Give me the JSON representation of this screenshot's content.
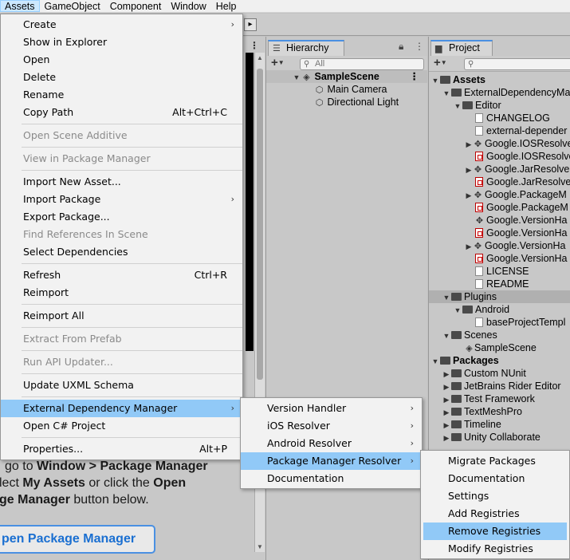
{
  "menubar": [
    "Assets",
    "GameObject",
    "Component",
    "Window",
    "Help"
  ],
  "hierarchy": {
    "tab": "Hierarchy",
    "search_placeholder": "All",
    "scene": "SampleScene",
    "items": [
      "Main Camera",
      "Directional Light"
    ]
  },
  "project": {
    "tab": "Project",
    "assets": "Assets",
    "edm": "ExternalDependencyMa",
    "editor": "Editor",
    "editor_items": [
      "CHANGELOG",
      "external-depender",
      "Google.IOSResolve",
      "Google.IOSResolve",
      "Google.JarResolve",
      "Google.JarResolve",
      "Google.PackageM",
      "Google.PackageM",
      "Google.VersionHa",
      "Google.VersionHa",
      "Google.VersionHa",
      "Google.VersionHa",
      "LICENSE",
      "README"
    ],
    "plugins": "Plugins",
    "android": "Android",
    "base_template": "baseProjectTempl",
    "scenes": "Scenes",
    "sample_scene": "SampleScene",
    "packages": "Packages",
    "package_items": [
      "Custom NUnit",
      "JetBrains Rider Editor",
      "Test Framework",
      "TextMeshPro",
      "Timeline",
      "Unity Collaborate"
    ]
  },
  "inspector": {
    "line1_a": "go to ",
    "line1_b": "Window > Package Manager",
    "line2_a": "lect ",
    "line2_b": "My Assets",
    "line2_c": " or click the ",
    "line2_d": "Open",
    "line3_a": "ge Manager",
    "line3_b": " button below.",
    "button": "pen Package Manager"
  },
  "assets_menu": {
    "items": [
      {
        "label": "Create",
        "sub": true
      },
      {
        "label": "Show in Explorer"
      },
      {
        "label": "Open"
      },
      {
        "label": "Delete"
      },
      {
        "label": "Rename"
      },
      {
        "label": "Copy Path",
        "shortcut": "Alt+Ctrl+C"
      },
      {
        "label": "Open Scene Additive",
        "disabled": true
      },
      {
        "label": "View in Package Manager",
        "disabled": true
      },
      {
        "label": "Import New Asset..."
      },
      {
        "label": "Import Package",
        "sub": true
      },
      {
        "label": "Export Package..."
      },
      {
        "label": "Find References In Scene",
        "disabled": true
      },
      {
        "label": "Select Dependencies"
      },
      {
        "label": "Refresh",
        "shortcut": "Ctrl+R"
      },
      {
        "label": "Reimport"
      },
      {
        "label": "Reimport All"
      },
      {
        "label": "Extract From Prefab",
        "disabled": true
      },
      {
        "label": "Run API Updater...",
        "disabled": true
      },
      {
        "label": "Update UXML Schema"
      },
      {
        "label": "External Dependency Manager",
        "sub": true,
        "highlight": true
      },
      {
        "label": "Open C# Project"
      },
      {
        "label": "Properties...",
        "shortcut": "Alt+P"
      }
    ]
  },
  "edm_menu": {
    "items": [
      {
        "label": "Version Handler",
        "sub": true
      },
      {
        "label": "iOS Resolver",
        "sub": true
      },
      {
        "label": "Android Resolver",
        "sub": true
      },
      {
        "label": "Package Manager Resolver",
        "sub": true,
        "highlight": true
      },
      {
        "label": "Documentation"
      }
    ]
  },
  "pmr_menu": {
    "items": [
      {
        "label": "Migrate Packages"
      },
      {
        "label": "Documentation"
      },
      {
        "label": "Settings"
      },
      {
        "label": "Add Registries"
      },
      {
        "label": "Remove Registries",
        "highlight": true
      },
      {
        "label": "Modify Registries"
      }
    ]
  },
  "shortcut_glyphs": {
    "submenu": "›"
  }
}
